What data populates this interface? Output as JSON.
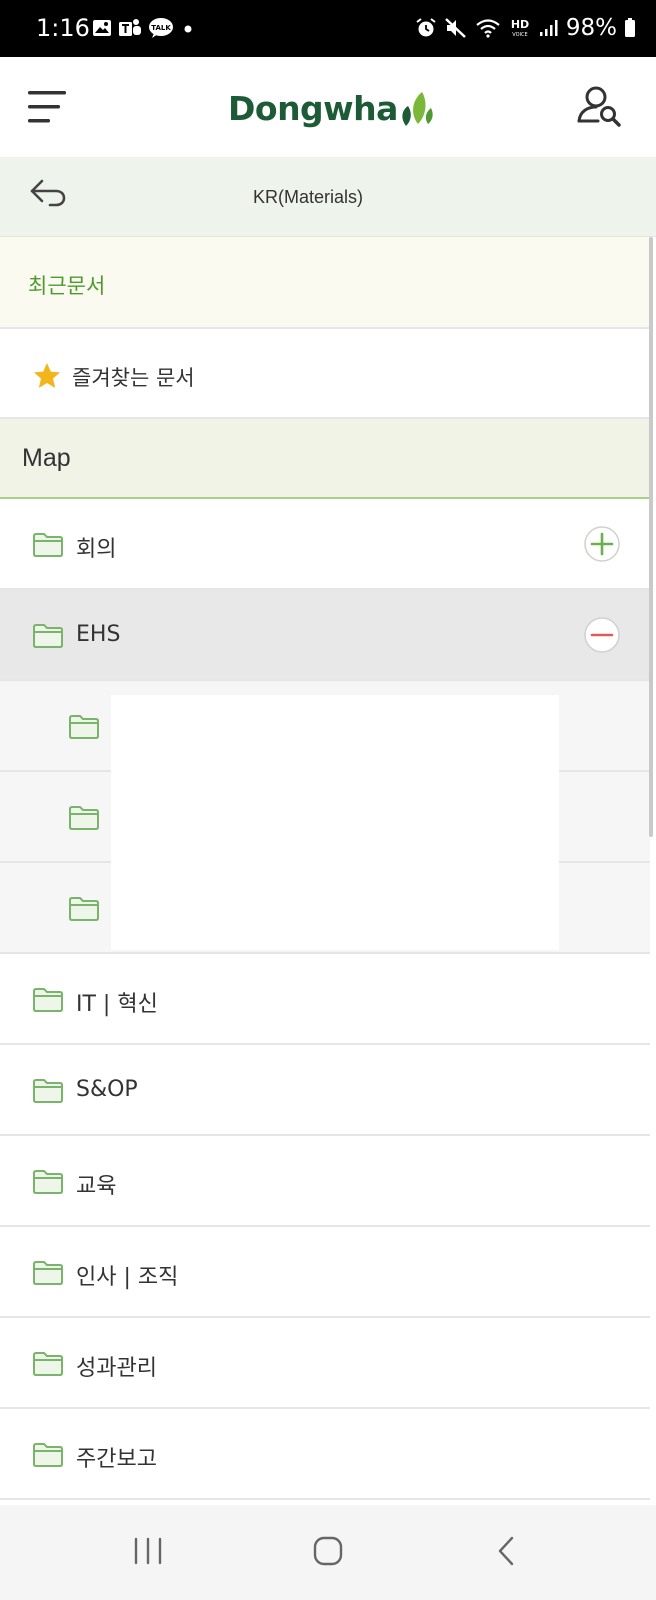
{
  "status_bar": {
    "time": "1:16",
    "battery": "98%",
    "notification_icons": [
      "gallery-icon",
      "teams-icon",
      "kakaotalk-icon",
      "dot-icon"
    ],
    "system_icons": [
      "alarm-icon",
      "mute-icon",
      "wifi-icon",
      "hd-voice-icon",
      "signal-icon",
      "battery-icon"
    ],
    "talk_badge": "TALK",
    "hd_badge": "HD",
    "voice_badge": "VOICE"
  },
  "header": {
    "logo_text": "Dongwha",
    "brand_color": "#1d5b37",
    "leaf_color": "#7bb83a",
    "menu_icon": "hamburger-icon",
    "user_search_icon": "user-search-icon"
  },
  "sub_header": {
    "back_icon": "back-arrow-icon",
    "title": "KR(Materials)"
  },
  "sections": {
    "recent_documents": "최근문서",
    "favorite_documents": "즐겨찾는 문서",
    "map_title": "Map"
  },
  "tree": {
    "folder_color": "#7ab36b",
    "items": [
      {
        "label": "회의",
        "state": "collapsed",
        "toggle_icon": "plus-circle-icon"
      },
      {
        "label": "EHS",
        "state": "expanded",
        "toggle_icon": "minus-circle-icon"
      },
      {
        "label": "IT | 혁신"
      },
      {
        "label": "S&OP"
      },
      {
        "label": "교육"
      },
      {
        "label": "인사 | 조직"
      },
      {
        "label": "성과관리"
      },
      {
        "label": "주간보고"
      }
    ],
    "ehs_children_count": 3
  },
  "nav_bar": {
    "icons": [
      "recent-apps-icon",
      "home-icon",
      "back-icon"
    ]
  }
}
